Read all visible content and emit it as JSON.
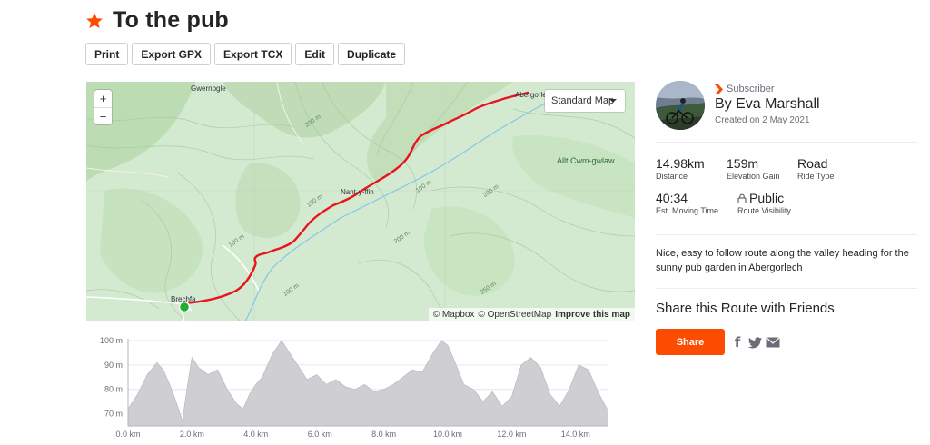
{
  "route": {
    "title": "To the pub",
    "star_color": "#fc4c02"
  },
  "toolbar": {
    "print": "Print",
    "export_gpx": "Export GPX",
    "export_tcx": "Export TCX",
    "edit": "Edit",
    "duplicate": "Duplicate"
  },
  "map": {
    "zoom_in": "+",
    "zoom_out": "−",
    "style_selector": "Standard Map",
    "places": {
      "gwernogle": "Gwernogle",
      "abergorlech": "Abergorle",
      "allt": "Allt Cwm-gwlaw",
      "nant": "Nant-y-ffin",
      "brechfa": "Brechfa"
    },
    "contours": {
      "c200a": "200 m",
      "c200b": "200 m",
      "c200c": "200 m",
      "c150": "150 m",
      "c100a": "100 m",
      "c100b": "100 m",
      "c100c": "100 m",
      "c250": "250 m"
    },
    "attribution": {
      "mapbox": "© Mapbox",
      "osm": "© OpenStreetMap",
      "improve": "Improve this map"
    },
    "route_color": "#e8141e",
    "start_marker_color": "#1fad34"
  },
  "elevation": {
    "y_ticks": [
      "100 m",
      "90 m",
      "80 m",
      "70 m"
    ],
    "x_ticks": [
      "0.0 km",
      "2.0 km",
      "4.0 km",
      "6.0 km",
      "8.0 km",
      "10.0 km",
      "12.0 km",
      "14.0 km"
    ]
  },
  "author": {
    "badge": "Subscriber",
    "name": "By Eva Marshall",
    "created": "Created on 2 May 2021"
  },
  "stats": {
    "distance_value": "14.98km",
    "distance_label": "Distance",
    "elevation_value": "159m",
    "elevation_label": "Elevation Gain",
    "ride_type_value": "Road",
    "ride_type_label": "Ride Type",
    "moving_time_value": "40:34",
    "moving_time_label": "Est. Moving Time",
    "visibility_value": "Public",
    "visibility_label": "Route Visibility"
  },
  "description": "Nice, easy to follow route along the valley heading for the sunny pub garden in Abergorlech",
  "share": {
    "title": "Share this Route with Friends",
    "button": "Share",
    "facebook_icon": "f",
    "accent_color": "#fc4c02"
  },
  "chart_data": {
    "type": "area",
    "x_unit": "km",
    "y_unit": "m",
    "ylim": [
      65,
      100
    ],
    "xlim": [
      0,
      15
    ],
    "x": [
      0,
      0.3,
      0.6,
      0.9,
      1.1,
      1.3,
      1.5,
      1.7,
      1.9,
      2.0,
      2.2,
      2.5,
      2.8,
      3.1,
      3.4,
      3.6,
      3.8,
      4.0,
      4.2,
      4.5,
      4.8,
      5.0,
      5.3,
      5.6,
      5.9,
      6.2,
      6.5,
      6.8,
      7.1,
      7.4,
      7.7,
      8.0,
      8.3,
      8.6,
      8.9,
      9.2,
      9.5,
      9.8,
      10.0,
      10.2,
      10.5,
      10.8,
      11.1,
      11.4,
      11.7,
      12.0,
      12.3,
      12.6,
      12.9,
      13.2,
      13.5,
      13.8,
      14.1,
      14.4,
      14.7,
      14.98
    ],
    "y": [
      72,
      78,
      86,
      91,
      88,
      82,
      75,
      67,
      85,
      93,
      89,
      86,
      88,
      80,
      74,
      72,
      78,
      82,
      85,
      94,
      100,
      96,
      90,
      84,
      86,
      82,
      84,
      81,
      80,
      82,
      79,
      80,
      82,
      85,
      88,
      87,
      94,
      100,
      98,
      92,
      82,
      80,
      75,
      79,
      73,
      77,
      90,
      93,
      89,
      78,
      73,
      80,
      90,
      88,
      79,
      72
    ]
  }
}
